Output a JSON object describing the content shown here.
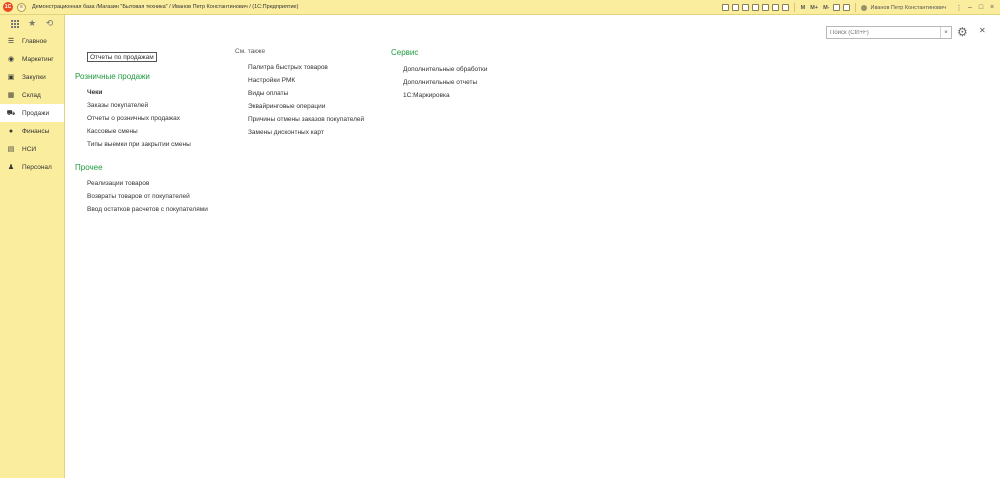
{
  "titlebar": {
    "logo": "1С",
    "title": "Демонстрационная база /Магазин \"Бытовая техника\" / Иванов Петр Константинович /  (1С:Предприятие)",
    "m_labels": [
      "M",
      "M+",
      "M-"
    ],
    "user": "Иванов Петр Константинович",
    "icons": [
      "save-icon",
      "print-icon",
      "copy-icon",
      "paste-icon",
      "preview-icon",
      "calendar-icon",
      "calculator-icon",
      "zoom-icon",
      "info-icon"
    ]
  },
  "sidebar": {
    "items": [
      {
        "label": "Главное",
        "icon": "menu-icon",
        "glyph": "☰"
      },
      {
        "label": "Маркетинг",
        "icon": "marketing-icon",
        "glyph": "◉"
      },
      {
        "label": "Закупки",
        "icon": "purchases-icon",
        "glyph": "▣"
      },
      {
        "label": "Склад",
        "icon": "warehouse-icon",
        "glyph": "▦"
      },
      {
        "label": "Продажи",
        "icon": "sales-icon",
        "glyph": "⛟"
      },
      {
        "label": "Финансы",
        "icon": "finance-icon",
        "glyph": "●"
      },
      {
        "label": "НСИ",
        "icon": "reference-icon",
        "glyph": "▤"
      },
      {
        "label": "Персонал",
        "icon": "personnel-icon",
        "glyph": "♟"
      }
    ],
    "active": "Продажи"
  },
  "search": {
    "placeholder": "Поиск (Ctrl+F)",
    "clear": "×"
  },
  "main": {
    "report_button": "Отчеты по продажам",
    "retail": {
      "title": "Розничные продажи",
      "links": [
        "Чеки",
        "Заказы покупателей",
        "Отчеты о розничных продажах",
        "Кассовые смены",
        "Типы выемки при закрытии смены"
      ]
    },
    "other": {
      "title": "Прочее",
      "links": [
        "Реализации товаров",
        "Возвраты товаров от покупателей",
        "Ввод остатков расчетов с покупателями"
      ]
    },
    "see_also": {
      "title": "См. также",
      "links": [
        "Палитра быстрых товаров",
        "Настройки РМК",
        "Виды оплаты",
        "Эквайринговые операции",
        "Причины отмены заказов покупателей",
        "Замены дисконтных карт"
      ]
    },
    "service": {
      "title": "Сервис",
      "links": [
        "Дополнительные обработки",
        "Дополнительные отчеты",
        "1С:Маркировка"
      ]
    }
  },
  "colors": {
    "accent_green": "#1f9a3e",
    "panel_yellow": "#fbed9e"
  }
}
